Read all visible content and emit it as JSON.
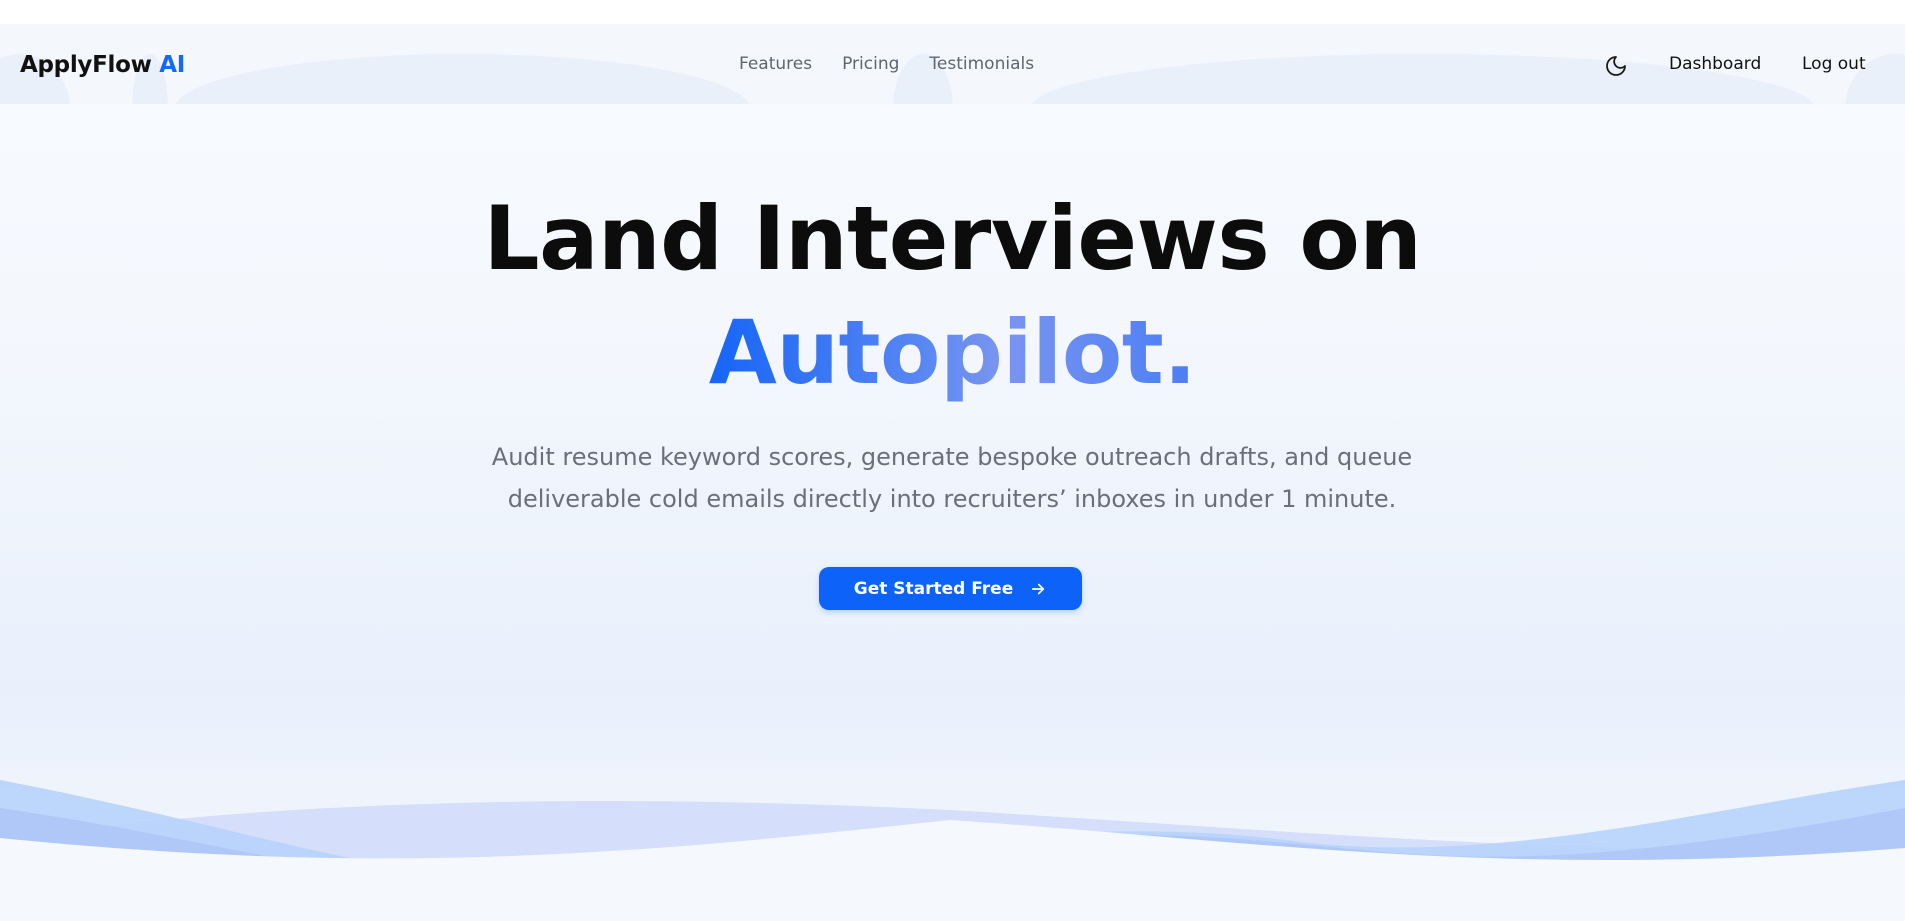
{
  "header": {
    "logo_text": "ApplyFlow",
    "logo_accent": "AI",
    "nav": [
      "Features",
      "Pricing",
      "Testimonials"
    ],
    "theme_icon": "moon-icon",
    "dashboard_label": "Dashboard",
    "logout_label": "Log out"
  },
  "hero": {
    "title_line1": "Land Interviews on",
    "title_line2": "Autopilot.",
    "subtitle_line1": "Audit resume keyword scores, generate bespoke outreach drafts, and queue",
    "subtitle_line2": "deliverable cold emails directly into recruiters’ inboxes in under 1 minute.",
    "cta_label": "Get Started Free",
    "cta_icon": "arrow-right-icon"
  },
  "colors": {
    "brand": "#1769f5",
    "cta": "#0d63f9",
    "heading": "#0c0c0c",
    "subtitle": "#6a6f78",
    "wave_light": "#d5defa",
    "wave_mid": "#b9d2fb",
    "wave_dark": "#a6bef6"
  }
}
